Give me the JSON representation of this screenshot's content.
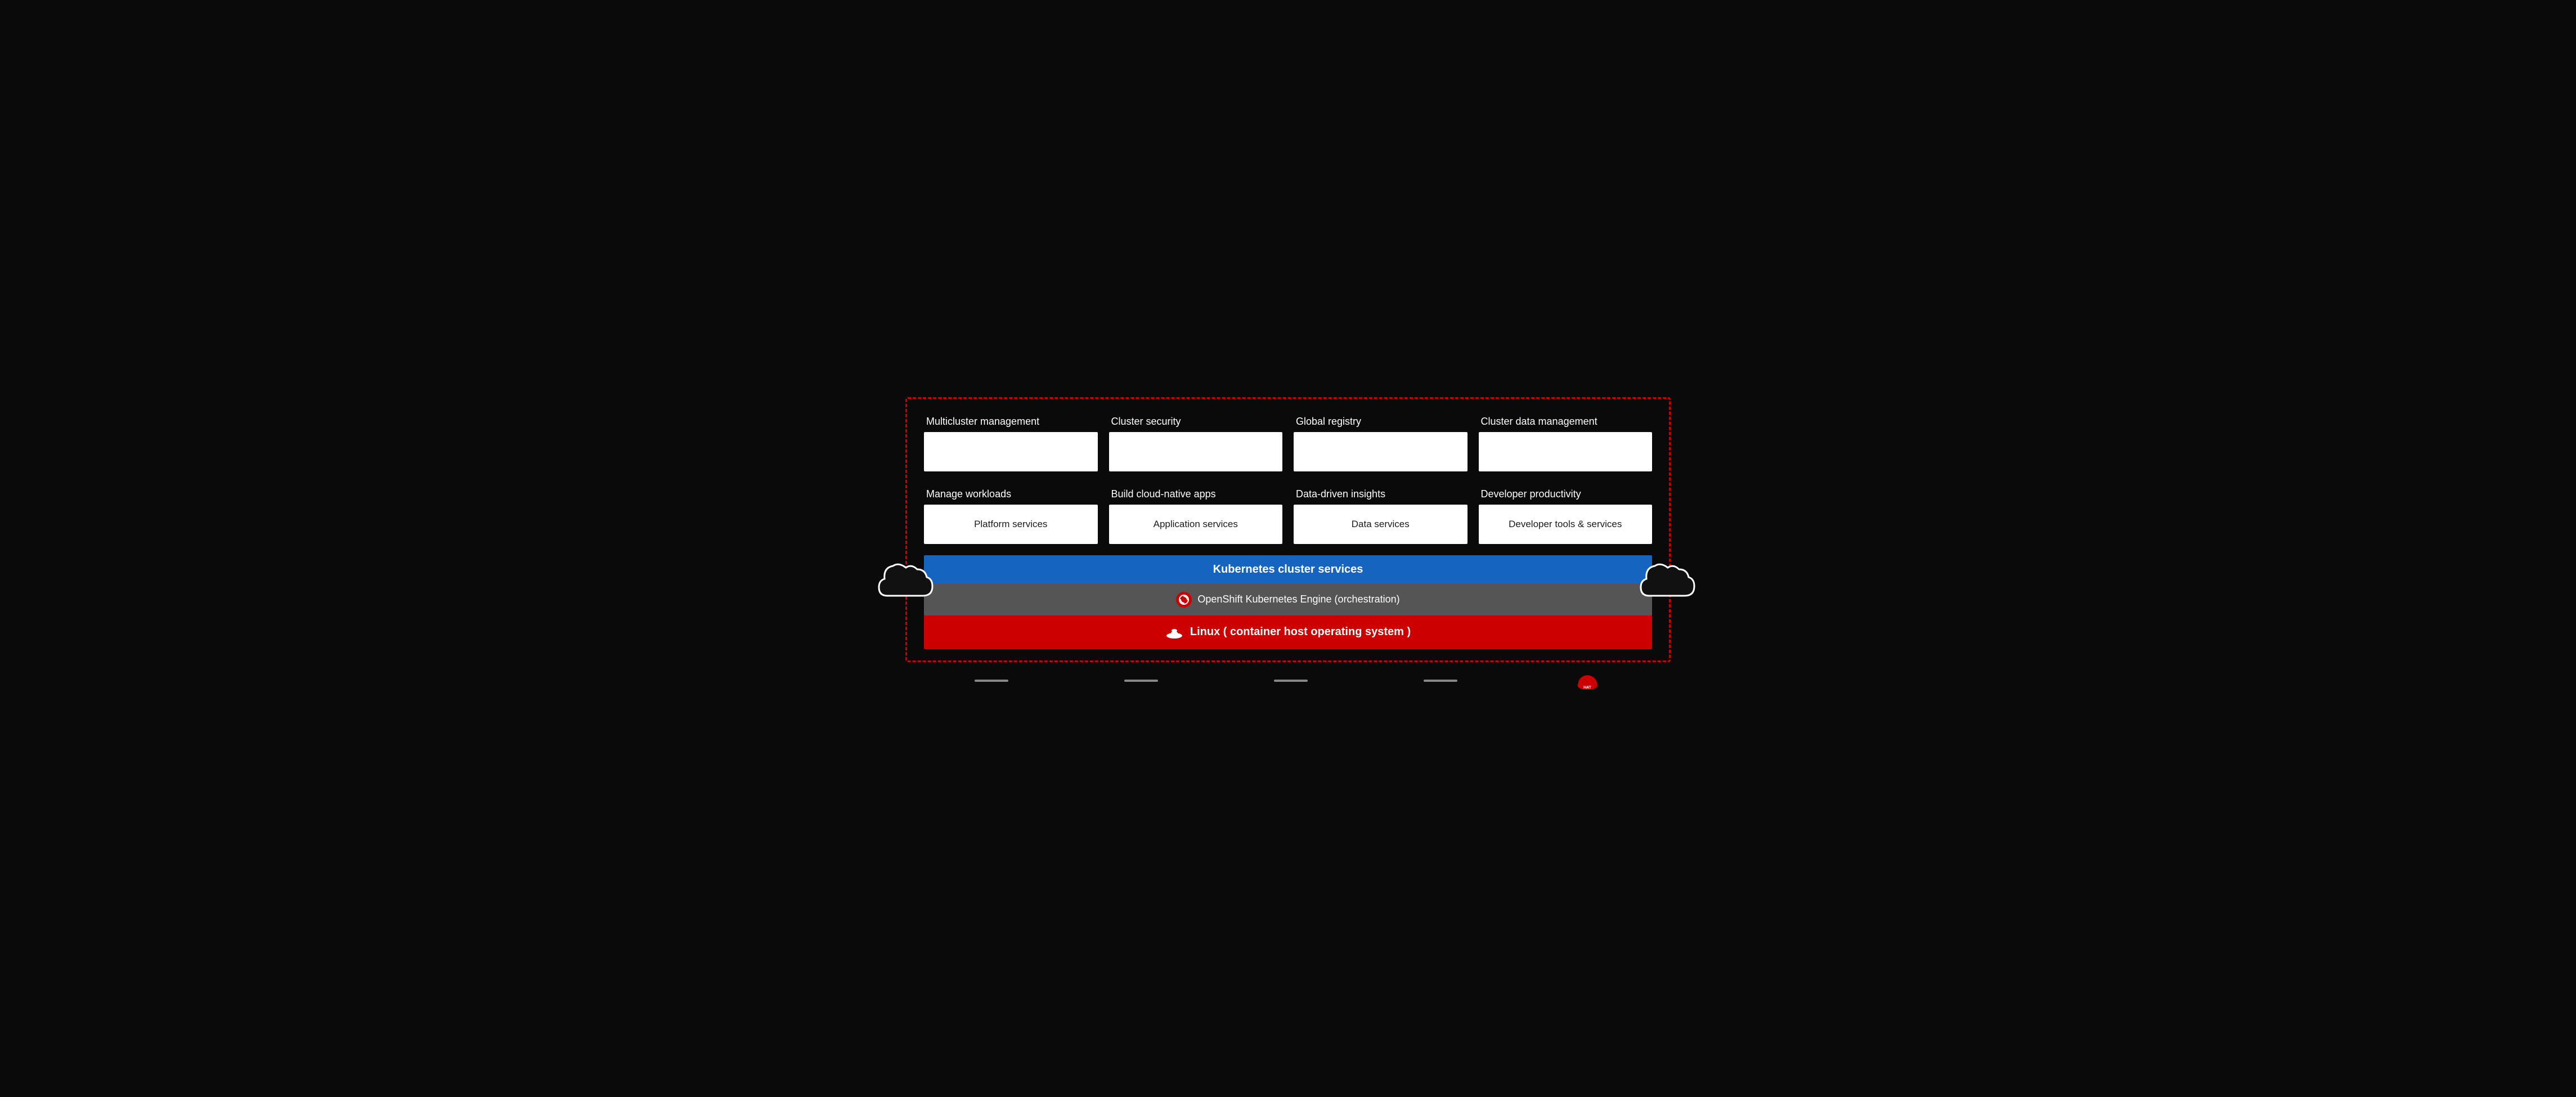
{
  "diagram": {
    "top_row": [
      {
        "label": "Multicluster management",
        "box_text": ""
      },
      {
        "label": "Cluster security",
        "box_text": ""
      },
      {
        "label": "Global registry",
        "box_text": ""
      },
      {
        "label": "Cluster data management",
        "box_text": ""
      }
    ],
    "bottom_row": [
      {
        "label": "Manage workloads",
        "box_text": "Platform services"
      },
      {
        "label": "Build cloud-native apps",
        "box_text": "Application services"
      },
      {
        "label": "Data-driven insights",
        "box_text": "Data services"
      },
      {
        "label": "Developer productivity",
        "box_text": "Developer tools & services"
      }
    ],
    "k8s_bar": "Kubernetes cluster services",
    "openshift_bar": "OpenShift Kubernetes Engine (orchestration)",
    "linux_bar": "Linux ( container host operating system )"
  }
}
